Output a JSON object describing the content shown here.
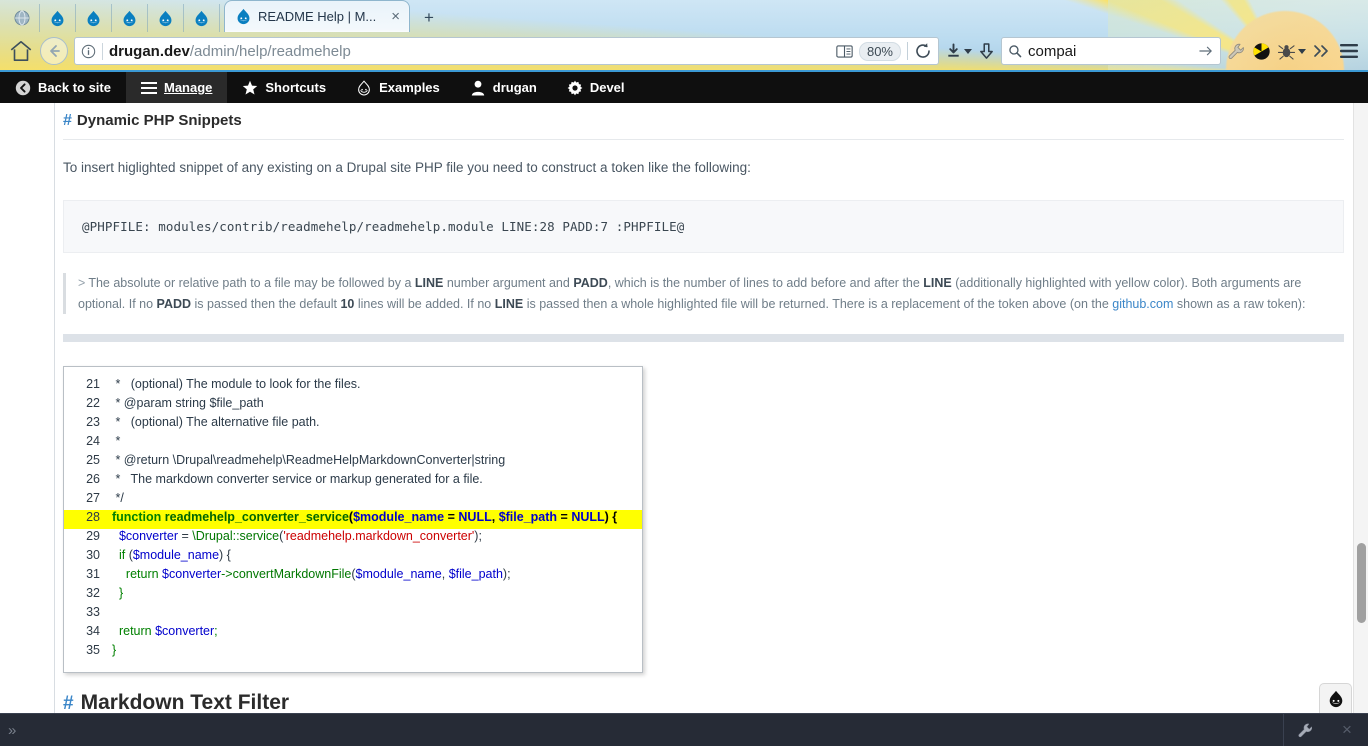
{
  "browser": {
    "tabs_mini": [
      {
        "icon": "globe-icon",
        "name": "tab-mini-globe"
      },
      {
        "icon": "drupal-droplet-icon",
        "name": "tab-mini-drupal-1"
      },
      {
        "icon": "drupal-droplet-icon",
        "name": "tab-mini-drupal-2"
      },
      {
        "icon": "drupal-droplet-icon",
        "name": "tab-mini-drupal-3"
      },
      {
        "icon": "drupal-droplet-icon",
        "name": "tab-mini-drupal-4"
      },
      {
        "icon": "drupal-droplet-icon",
        "name": "tab-mini-drupal-5"
      }
    ],
    "active_tab": {
      "title": "README Help | M...",
      "favicon": "drupal-droplet-icon",
      "close_label": "×"
    },
    "new_tab_label": "+",
    "nav": {
      "home_icon": "home-icon",
      "back_icon": "back-arrow-icon",
      "info_icon": "page-info-icon",
      "url_host": "drugan.dev",
      "url_path": "/admin/help/readmehelp",
      "reader_icon": "reader-mode-icon",
      "zoom_level": "80%",
      "reload_icon": "reload-icon",
      "download_icon": "download-icon",
      "download_caret": "chevron-down-icon",
      "save_icon": "save-arrow-icon",
      "search_placeholder": "Search",
      "search_value": "compai",
      "search_go_icon": "arrow-right-icon",
      "ext_wrench_icon": "wrench-icon",
      "ext_adblock_icon": "adblock-icon",
      "ext_bug_icon": "bug-icon",
      "ext_bug_caret": "chevron-down-icon",
      "overflow_icon": "double-chevron-icon",
      "menu_icon": "hamburger-menu-icon"
    }
  },
  "admin_toolbar": {
    "items": [
      {
        "label": "Back to site",
        "icon": "back-circle-icon",
        "active": false
      },
      {
        "label": "Manage",
        "icon": "hamburger-icon",
        "active": true
      },
      {
        "label": "Shortcuts",
        "icon": "star-icon",
        "active": false
      },
      {
        "label": "Examples",
        "icon": "drupal-droplet-outline-icon",
        "active": false
      },
      {
        "label": "drugan",
        "icon": "user-icon",
        "active": false
      },
      {
        "label": "Devel",
        "icon": "gear-icon",
        "active": false
      }
    ]
  },
  "content": {
    "section_heading": {
      "hash": "#",
      "title": "Dynamic PHP Snippets"
    },
    "intro_paragraph": "To insert higlighted snippet of any existing on a Drupal site PHP file you need to construct a token like the following:",
    "token_code": "@PHPFILE: modules/contrib/readmehelp/readmehelp.module LINE:28 PADD:7 :PHPFILE@",
    "blockquote": {
      "gt": ">",
      "p1a": "The absolute or relative path to a file may be followed by a ",
      "b1": "LINE",
      "p1b": " number argument and ",
      "b2": "PADD",
      "p1c": ", which is the number of lines to add before and after the ",
      "b3": "LINE",
      "p1d": " (additionally highlighted with yellow color). Both arguments are optional. If no ",
      "b4": "PADD",
      "p1e": " is passed then the default ",
      "b5": "10",
      "p1f": " lines will be added. If no ",
      "b6": "LINE",
      "p1g": " is passed then a whole highlighted file will be returned. There is a replacement of the token above (on the ",
      "link": "github.com",
      "p1h": " shown as a raw token):"
    },
    "bottom_heading": {
      "hash": "#",
      "title": "Markdown Text Filter"
    }
  },
  "code_snippet": {
    "highlight_line": 28,
    "lines": [
      {
        "n": "21",
        "html": "<span class='cm'> *   (optional) The module to look for the files.</span>"
      },
      {
        "n": "22",
        "html": "<span class='cm'> * @param string $file_path</span>"
      },
      {
        "n": "23",
        "html": "<span class='cm'> *   (optional) The alternative file path.</span>"
      },
      {
        "n": "24",
        "html": "<span class='cm'> *</span>"
      },
      {
        "n": "25",
        "html": "<span class='cm'> * @return \\Drupal\\readmehelp\\ReadmeHelpMarkdownConverter|string</span>"
      },
      {
        "n": "26",
        "html": "<span class='cm'> *   The markdown converter service or markup generated for a file.</span>"
      },
      {
        "n": "27",
        "html": "<span class='cm'> */</span>"
      },
      {
        "n": "28",
        "html": "<span class='kw'>function</span> <span class='fn'>readmehelp_converter_service</span><span class='pnb'>(</span><span class='varb'>$module_name</span> <span class='pnb'>=</span> <span class='nul'>NULL</span><span class='pnb'>,</span> <span class='varb'>$file_path</span> <span class='pnb'>=</span> <span class='nul'>NULL</span><span class='pnb'>) {</span>"
      },
      {
        "n": "29",
        "html": "  <span class='var'>$converter</span> <span class='pn'>=</span> <span class='meth'>\\Drupal::service</span><span class='pn'>(</span><span class='str'>'readmehelp.markdown_converter'</span><span class='pn'>);</span>"
      },
      {
        "n": "30",
        "html": "  <span class='kws'>if</span> <span class='pn'>(</span><span class='var'>$module_name</span><span class='pn'>) {</span>"
      },
      {
        "n": "31",
        "html": "    <span class='kws'>return</span> <span class='var'>$converter</span><span class='meth'>-&gt;convertMarkdownFile</span><span class='pn'>(</span><span class='var'>$module_name</span><span class='pn'>,</span> <span class='var'>$file_path</span><span class='pn'>);</span>"
      },
      {
        "n": "32",
        "html": "  <span class='kws'>}</span>"
      },
      {
        "n": "33",
        "html": ""
      },
      {
        "n": "34",
        "html": "  <span class='kws'>return</span> <span class='var'>$converter</span><span class='kws'>;</span>"
      },
      {
        "n": "35",
        "html": "<span class='kws'>}</span>"
      }
    ]
  },
  "devbar": {
    "expand_icon": "double-chevron-right-icon",
    "wrench_icon": "wrench-icon",
    "close_label": "×"
  },
  "colors": {
    "accent_blue": "#3b86c8",
    "toolbar_black": "#0f0f0f",
    "highlight_yellow": "#ffff00",
    "devbar_dark": "#262b36"
  }
}
